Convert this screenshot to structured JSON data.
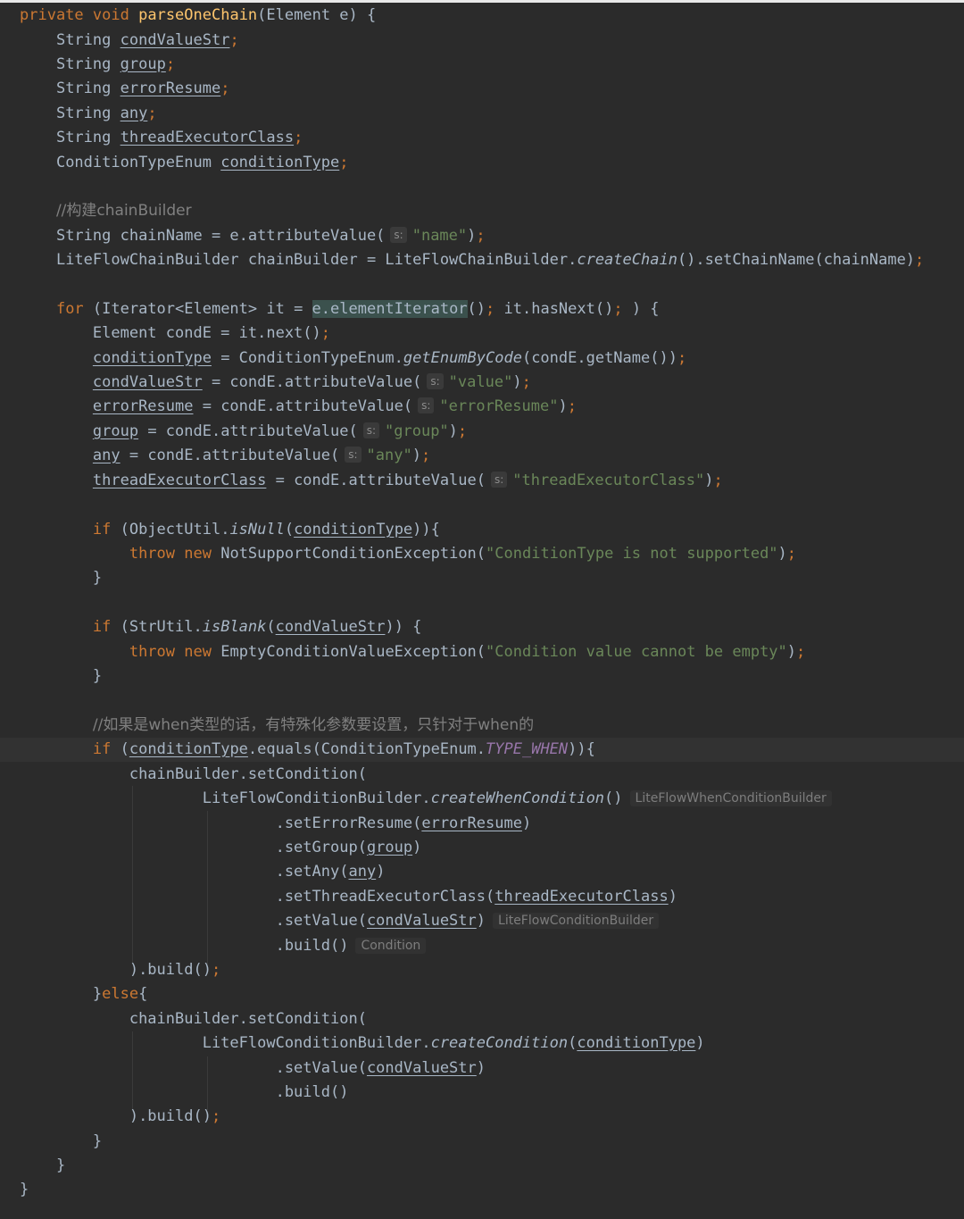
{
  "code": {
    "l1": {
      "kw1": "private",
      "kw2": "void",
      "method": "parseOneChain",
      "rest": "(Element e) {"
    },
    "l2": {
      "type": "String",
      "field": "condValueStr",
      "semi": ";"
    },
    "l3": {
      "type": "String",
      "field": "group",
      "semi": ";"
    },
    "l4": {
      "type": "String",
      "field": "errorResume",
      "semi": ";"
    },
    "l5": {
      "type": "String",
      "field": "any",
      "semi": ";"
    },
    "l6": {
      "type": "String",
      "field": "threadExecutorClass",
      "semi": ";"
    },
    "l7": {
      "type": "ConditionTypeEnum",
      "field": "conditionType",
      "semi": ";"
    },
    "l9": {
      "comment": "//构建chainBuilder"
    },
    "l10": {
      "pre": "String chainName = e.attributeValue(",
      "hint": "s:",
      "str": "\"name\"",
      "post": ")",
      "semi": ";"
    },
    "l11": {
      "pre": "LiteFlowChainBuilder chainBuilder = LiteFlowChainBuilder.",
      "static": "createChain",
      "post": "().setChainName(chainName)",
      "semi": ";"
    },
    "l13": {
      "kw": "for",
      "pre": " (Iterator<Element> it = ",
      "highlight": "e.elementIterator",
      "mid": "()",
      "semi1": ";",
      "mid2": " it.hasNext()",
      "semi2": ";",
      "post": " ) {"
    },
    "l14": {
      "pre": "Element condE = it.next()",
      "semi": ";"
    },
    "l15": {
      "field": "conditionType",
      "pre": " = ConditionTypeEnum.",
      "static": "getEnumByCode",
      "post": "(condE.getName())",
      "semi": ";"
    },
    "l16": {
      "field": "condValueStr",
      "pre": " = condE.attributeValue(",
      "hint": "s:",
      "str": "\"value\"",
      "post": ")",
      "semi": ";"
    },
    "l17": {
      "field": "errorResume",
      "pre": " = condE.attributeValue(",
      "hint": "s:",
      "str": "\"errorResume\"",
      "post": ")",
      "semi": ";"
    },
    "l18": {
      "field": "group",
      "pre": " = condE.attributeValue(",
      "hint": "s:",
      "str": "\"group\"",
      "post": ")",
      "semi": ";"
    },
    "l19": {
      "field": "any",
      "pre": " = condE.attributeValue(",
      "hint": "s:",
      "str": "\"any\"",
      "post": ")",
      "semi": ";"
    },
    "l20": {
      "field": "threadExecutorClass",
      "pre": " = condE.attributeValue(",
      "hint": "s:",
      "str": "\"threadExecutorClass\"",
      "post": ")",
      "semi": ";"
    },
    "l22": {
      "kw": "if",
      "pre": " (ObjectUtil.",
      "static": "isNull",
      "open": "(",
      "field": "conditionType",
      "post": ")){"
    },
    "l23": {
      "kw1": "throw",
      "kw2": "new",
      "pre": " NotSupportConditionException(",
      "str": "\"ConditionType is not supported\"",
      "post": ")",
      "semi": ";"
    },
    "l24": {
      "text": "}"
    },
    "l26": {
      "kw": "if",
      "pre": " (StrUtil.",
      "static": "isBlank",
      "open": "(",
      "field": "condValueStr",
      "post": ")) {"
    },
    "l27": {
      "kw1": "throw",
      "kw2": "new",
      "pre": " EmptyConditionValueException(",
      "str": "\"Condition value cannot be empty\"",
      "post": ")",
      "semi": ";"
    },
    "l28": {
      "text": "}"
    },
    "l30": {
      "comment": "//如果是when类型的话，有特殊化参数要设置，只针对于when的"
    },
    "l31": {
      "kw": "if",
      "open": " (",
      "field": "conditionType",
      "pre": ".equals(ConditionTypeEnum.",
      "const": "TYPE_WHEN",
      "post": ")){"
    },
    "l32": {
      "text": "chainBuilder.setCondition("
    },
    "l33": {
      "pre": "LiteFlowConditionBuilder.",
      "static": "createWhenCondition",
      "post": "()",
      "typeHint": "LiteFlowWhenConditionBuilder"
    },
    "l34": {
      "pre": ".setErrorResume(",
      "field": "errorResume",
      "post": ")"
    },
    "l35": {
      "pre": ".setGroup(",
      "field": "group",
      "post": ")"
    },
    "l36": {
      "pre": ".setAny(",
      "field": "any",
      "post": ")"
    },
    "l37": {
      "pre": ".setThreadExecutorClass(",
      "field": "threadExecutorClass",
      "post": ")"
    },
    "l38": {
      "pre": ".setValue(",
      "field": "condValueStr",
      "post": ")",
      "typeHint": "LiteFlowConditionBuilder"
    },
    "l39": {
      "pre": ".build()",
      "typeHint": "Condition"
    },
    "l40": {
      "pre": ").build()",
      "semi": ";"
    },
    "l41": {
      "pre": "}",
      "kw": "else",
      "post": "{"
    },
    "l42": {
      "text": "chainBuilder.setCondition("
    },
    "l43": {
      "pre": "LiteFlowConditionBuilder.",
      "static": "createCondition",
      "open": "(",
      "field": "conditionType",
      "post": ")"
    },
    "l44": {
      "pre": ".setValue(",
      "field": "condValueStr",
      "post": ")"
    },
    "l45": {
      "pre": ".build()"
    },
    "l46": {
      "pre": ").build()",
      "semi": ";"
    },
    "l47": {
      "text": "}"
    },
    "l48": {
      "text": "}"
    },
    "l49": {
      "text": "}"
    }
  }
}
